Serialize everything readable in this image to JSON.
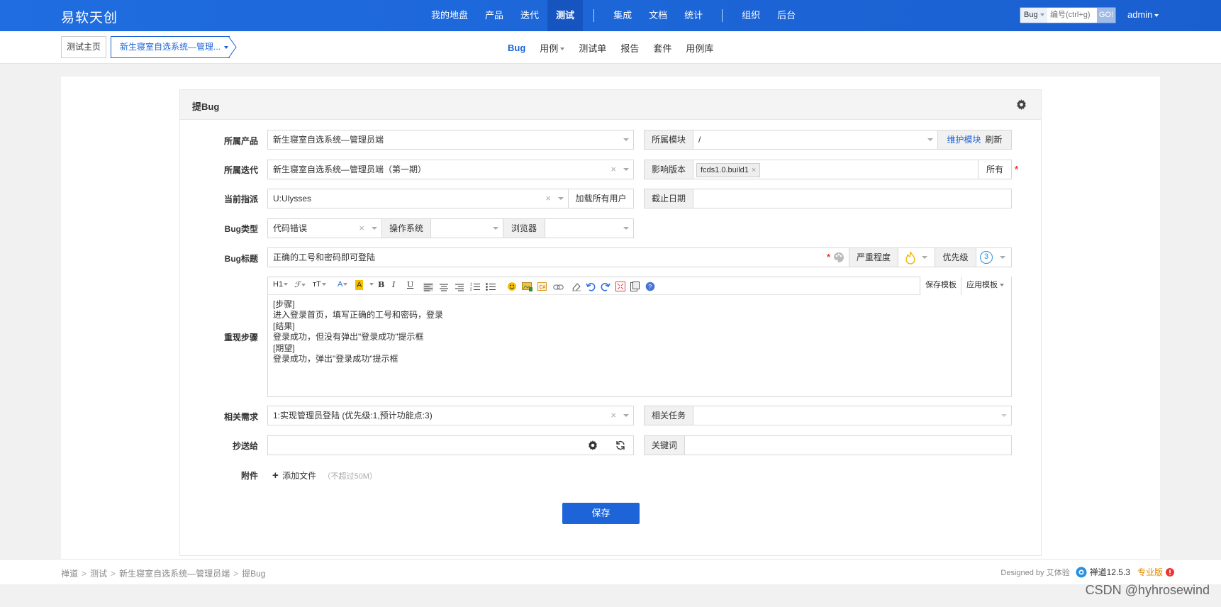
{
  "brand": "易软天创",
  "nav": {
    "items": [
      "我的地盘",
      "产品",
      "迭代",
      "测试",
      "集成",
      "文档",
      "统计",
      "组织",
      "后台"
    ],
    "active": "测试"
  },
  "search": {
    "type": "Bug",
    "placeholder": "编号(ctrl+g)",
    "go": "GO!"
  },
  "user": "admin",
  "crumbs": {
    "home": "测试主页",
    "product": "新生寝室自选系统—管理..."
  },
  "subnav": [
    "Bug",
    "用例",
    "测试单",
    "报告",
    "套件",
    "用例库"
  ],
  "panel": {
    "title": "提Bug"
  },
  "form": {
    "product_label": "所属产品",
    "product_value": "新生寝室自选系统—管理员端",
    "module_label": "所属模块",
    "module_value": "/",
    "maintain_module": "维护模块",
    "refresh": "刷新",
    "execution_label": "所属迭代",
    "execution_value": "新生寝室自选系统—管理员端（第一期）",
    "build_label": "影响版本",
    "build_tag": "fcds1.0.build1",
    "all": "所有",
    "assign_label": "当前指派",
    "assign_value": "U:Ulysses",
    "load_users": "加载所有用户",
    "deadline_label": "截止日期",
    "type_label": "Bug类型",
    "type_value": "代码错误",
    "os_label": "操作系统",
    "browser_label": "浏览器",
    "title_label": "Bug标题",
    "title_value": "正确的工号和密码即可登陆",
    "severity_label": "严重程度",
    "priority_label": "优先级",
    "priority_value": "3",
    "steps_label": "重现步骤",
    "save_template": "保存模板",
    "apply_template": "应用模板",
    "steps_lines": [
      "[步骤]",
      "进入登录首页，填写正确的工号和密码，登录",
      "[结果]",
      "登录成功，但没有弹出\"登录成功\"提示框",
      "[期望]",
      "登录成功，弹出\"登录成功\"提示框"
    ],
    "story_label": "相关需求",
    "story_value": "1:实现管理员登陆 (优先级:1,预计功能点:3)",
    "task_label": "相关任务",
    "mailto_label": "抄送给",
    "keywords_label": "关键词",
    "files_label": "附件",
    "add_file": "添加文件",
    "file_limit": "（不超过50M）",
    "save": "保存"
  },
  "footer": {
    "crumbs": [
      "禅道",
      "测试",
      "新生寝室自选系统—管理员端",
      "提Bug"
    ],
    "designed_by": "Designed by 艾体验",
    "version": "禅道12.5.3",
    "edition": "专业版"
  },
  "watermark": "CSDN @hyhrosewind",
  "colors": {
    "primary": "#1c64d8",
    "topbar": "#1f6de0",
    "required": "#ee3333",
    "severity": "#f5b400",
    "priority": "#2b8fe0"
  }
}
